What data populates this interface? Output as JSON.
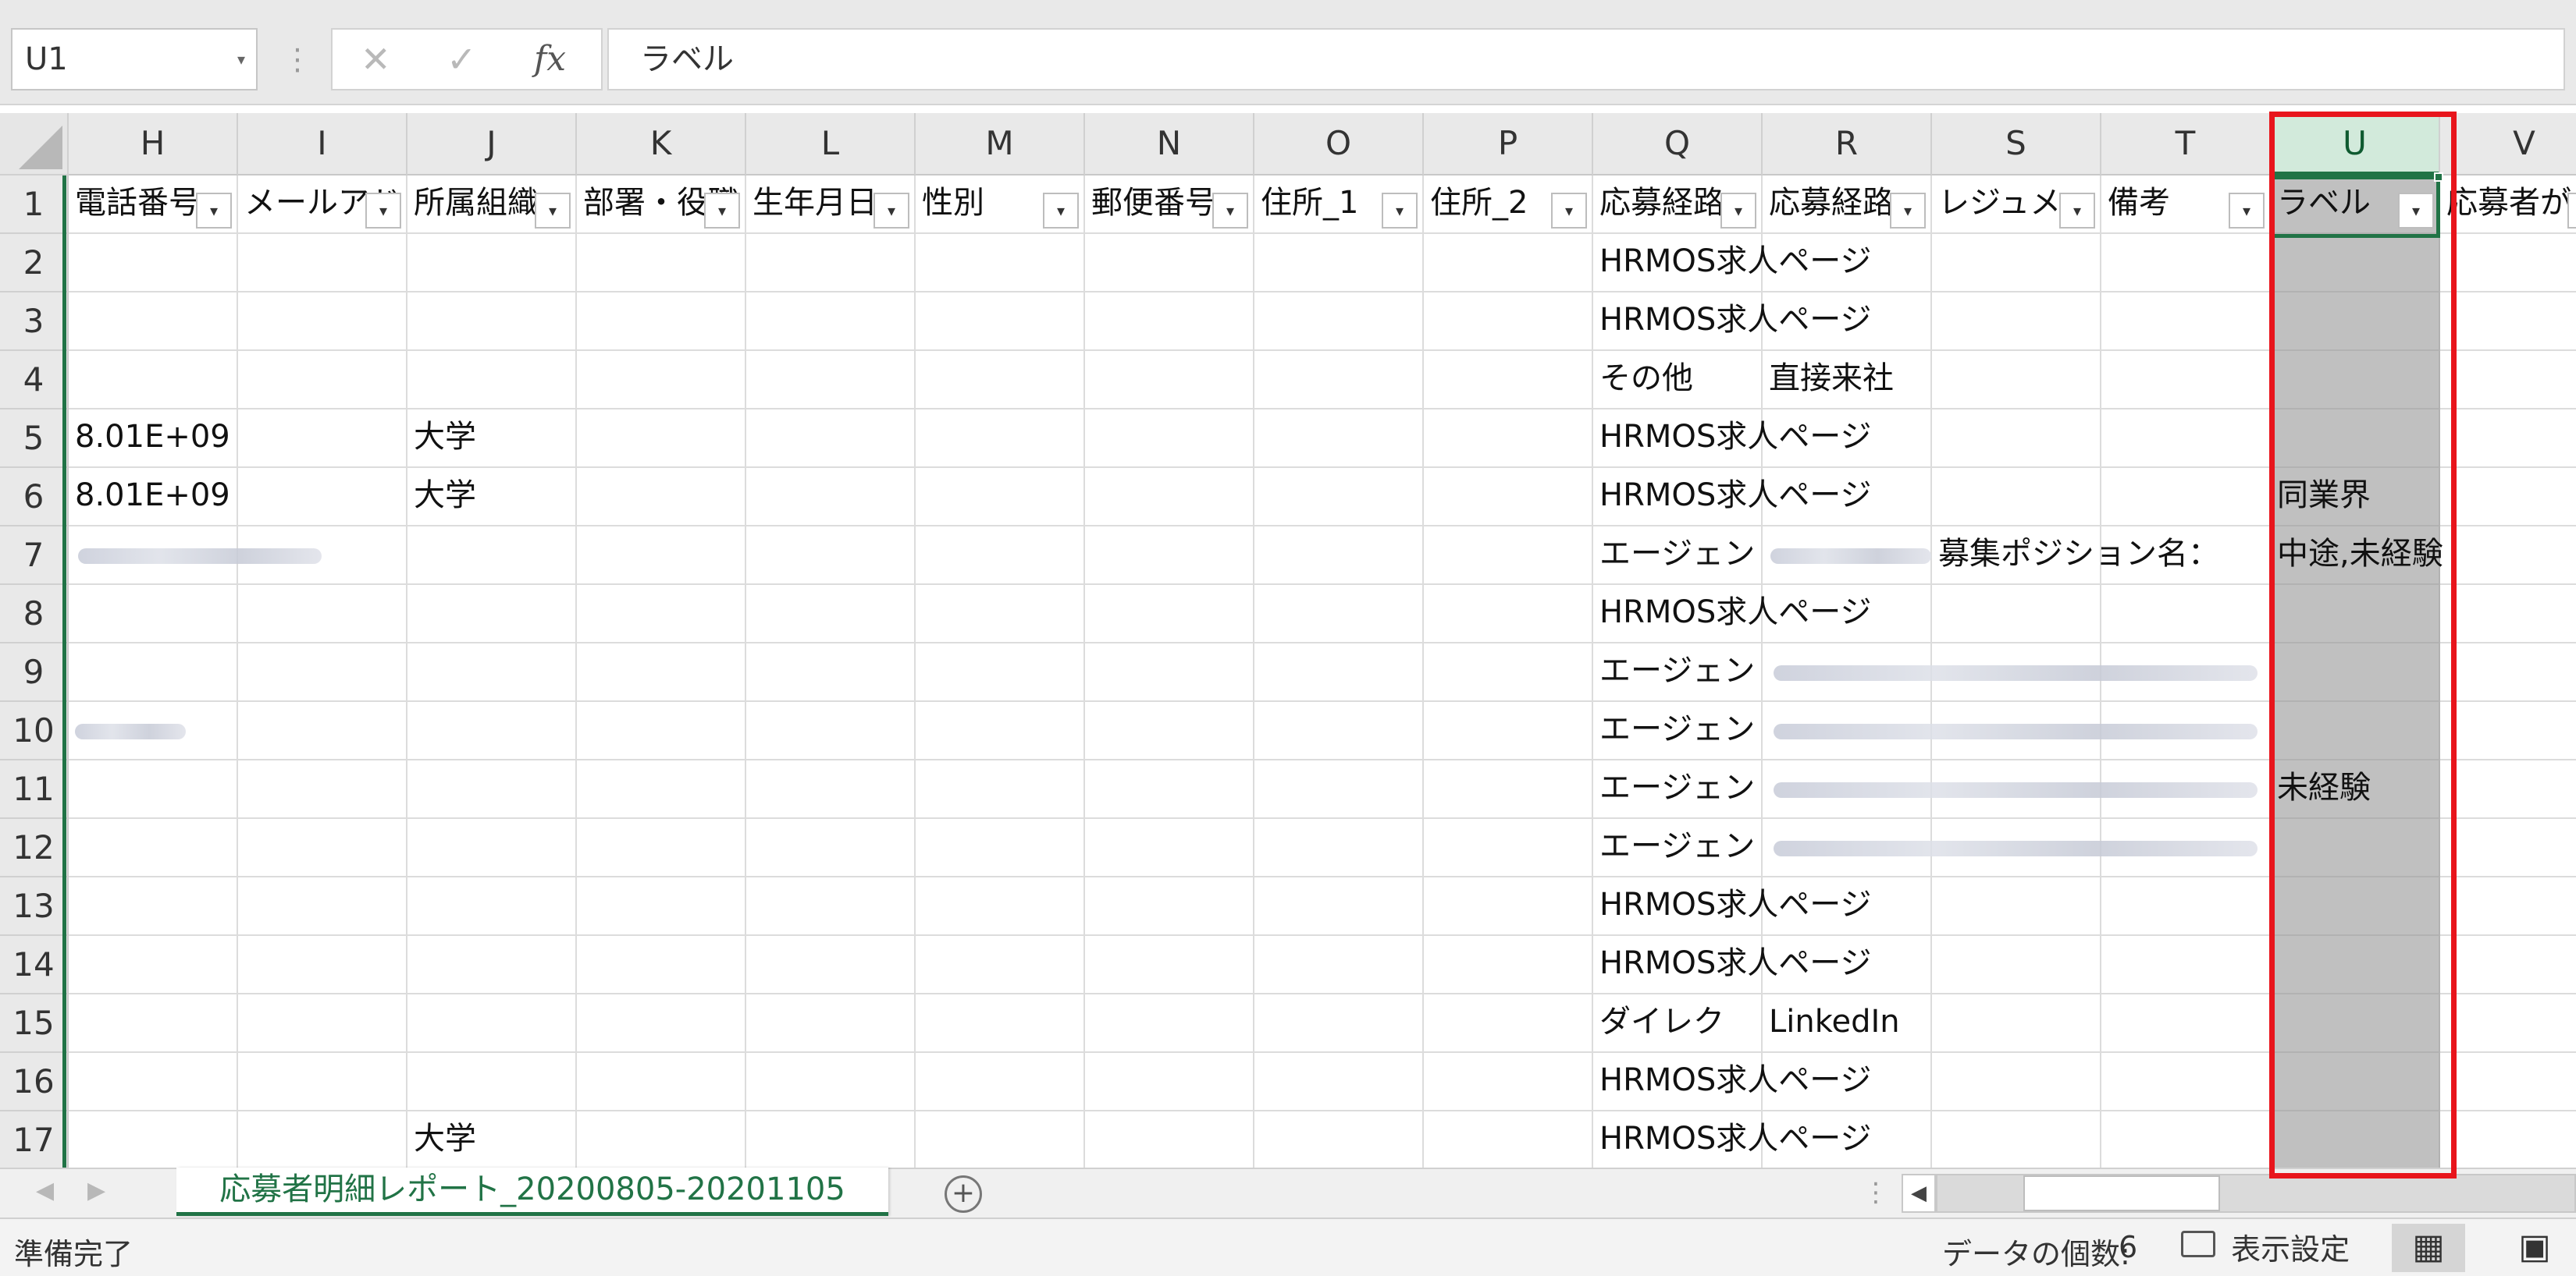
{
  "formula_bar": {
    "name_box": "U1",
    "name_box_arrow": "▾",
    "separator": "⋮",
    "cancel": "✕",
    "enter": "✓",
    "fx": "fx",
    "formula": "ラベル"
  },
  "columns": [
    {
      "letter": "H",
      "header": "電話番号",
      "selected": false
    },
    {
      "letter": "I",
      "header": "メールアドレス",
      "selected": false
    },
    {
      "letter": "J",
      "header": "所属組織",
      "selected": false
    },
    {
      "letter": "K",
      "header": "部署・役職",
      "selected": false
    },
    {
      "letter": "L",
      "header": "生年月日",
      "selected": false
    },
    {
      "letter": "M",
      "header": "性別",
      "selected": false
    },
    {
      "letter": "N",
      "header": "郵便番号",
      "selected": false
    },
    {
      "letter": "O",
      "header": "住所_1",
      "selected": false
    },
    {
      "letter": "P",
      "header": "住所_2",
      "selected": false
    },
    {
      "letter": "Q",
      "header": "応募経路",
      "selected": false
    },
    {
      "letter": "R",
      "header": "応募経路",
      "selected": false
    },
    {
      "letter": "S",
      "header": "レジュメ",
      "selected": false
    },
    {
      "letter": "T",
      "header": "備考",
      "selected": false
    },
    {
      "letter": "U",
      "header": "ラベル",
      "selected": true
    },
    {
      "letter": "V",
      "header": "応募者が",
      "selected": false
    }
  ],
  "filter_arrow": "▾",
  "row_numbers": [
    "1",
    "2",
    "3",
    "4",
    "5",
    "6",
    "7",
    "8",
    "9",
    "10",
    "11",
    "12",
    "13",
    "14",
    "15",
    "16",
    "17"
  ],
  "rows": [
    {
      "H": "",
      "J": "",
      "Q": "HRMOS求人ページ",
      "R": "",
      "S": "",
      "U": ""
    },
    {
      "H": "",
      "J": "",
      "Q": "HRMOS求人ページ",
      "R": "",
      "S": "",
      "U": ""
    },
    {
      "H": "",
      "J": "",
      "Q": "その他",
      "R": "直接来社",
      "S": "",
      "U": ""
    },
    {
      "H": "8.01E+09",
      "J": "大学",
      "Q": "HRMOS求人ページ",
      "R": "",
      "S": "",
      "U": ""
    },
    {
      "H": "8.01E+09",
      "J": "大学",
      "Q": "HRMOS求人ページ",
      "R": "",
      "S": "",
      "U": "同業界"
    },
    {
      "H": "",
      "J": "",
      "Q": "エージェン",
      "R": "",
      "S": "募集ポジション名：",
      "U": "中途,未経験"
    },
    {
      "H": "",
      "J": "",
      "Q": "HRMOS求人ページ",
      "R": "",
      "S": "",
      "U": ""
    },
    {
      "H": "",
      "J": "",
      "Q": "エージェン",
      "R": "",
      "S": "",
      "U": ""
    },
    {
      "H": "",
      "J": "",
      "Q": "エージェン",
      "R": "",
      "S": "",
      "U": ""
    },
    {
      "H": "",
      "J": "",
      "Q": "エージェン",
      "R": "",
      "S": "",
      "U": "未経験"
    },
    {
      "H": "",
      "J": "",
      "Q": "エージェン",
      "R": "",
      "S": "",
      "U": ""
    },
    {
      "H": "",
      "J": "",
      "Q": "HRMOS求人ページ",
      "R": "",
      "S": "",
      "U": ""
    },
    {
      "H": "",
      "J": "",
      "Q": "HRMOS求人ページ",
      "R": "",
      "S": "",
      "U": ""
    },
    {
      "H": "",
      "J": "",
      "Q": "ダイレク",
      "R": "LinkedIn",
      "S": "",
      "U": ""
    },
    {
      "H": "",
      "J": "",
      "Q": "HRMOS求人ページ",
      "R": "",
      "S": "",
      "U": ""
    },
    {
      "H": "",
      "J": "大学",
      "Q": "HRMOS求人ページ",
      "R": "",
      "S": "",
      "U": ""
    }
  ],
  "sheet_bar": {
    "nav_left": "◀",
    "nav_right": "▶",
    "sheet_tab": "応募者明細レポート_20200805-20201105",
    "add_sheet": "+",
    "separator": "⋮",
    "scroll_left": "◀"
  },
  "status_bar": {
    "status": "準備完了",
    "count_label": "データの個数:",
    "count_value": "6",
    "display_settings": "表示設定",
    "normal_view": "▦",
    "page_layout": "▣"
  },
  "colors": {
    "excel_green": "#217346",
    "highlight_red": "#e8151c",
    "selection_gray": "#c0c0c0"
  }
}
